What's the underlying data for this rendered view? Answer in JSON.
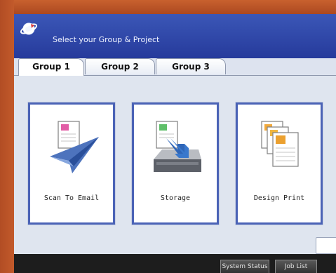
{
  "header": {
    "title": "Select your Group & Project",
    "logo_icon": "satellite-ring-logo"
  },
  "tabs": [
    {
      "label": "Group 1",
      "active": true
    },
    {
      "label": "Group 2",
      "active": false
    },
    {
      "label": "Group 3",
      "active": false
    }
  ],
  "tiles": [
    {
      "label": "Scan To Email",
      "icon": "paper-plane-scan-icon"
    },
    {
      "label": "Storage",
      "icon": "storage-drive-icon"
    },
    {
      "label": "Design Print",
      "icon": "stacked-documents-icon"
    }
  ],
  "footer": {
    "system_status_label": "System Status",
    "job_list_label": "Job List"
  },
  "colors": {
    "title_bar": "#2f49aa",
    "tile_border": "#4b63b6",
    "bezel": "#b5532b",
    "footer": "#1d1d1d"
  }
}
